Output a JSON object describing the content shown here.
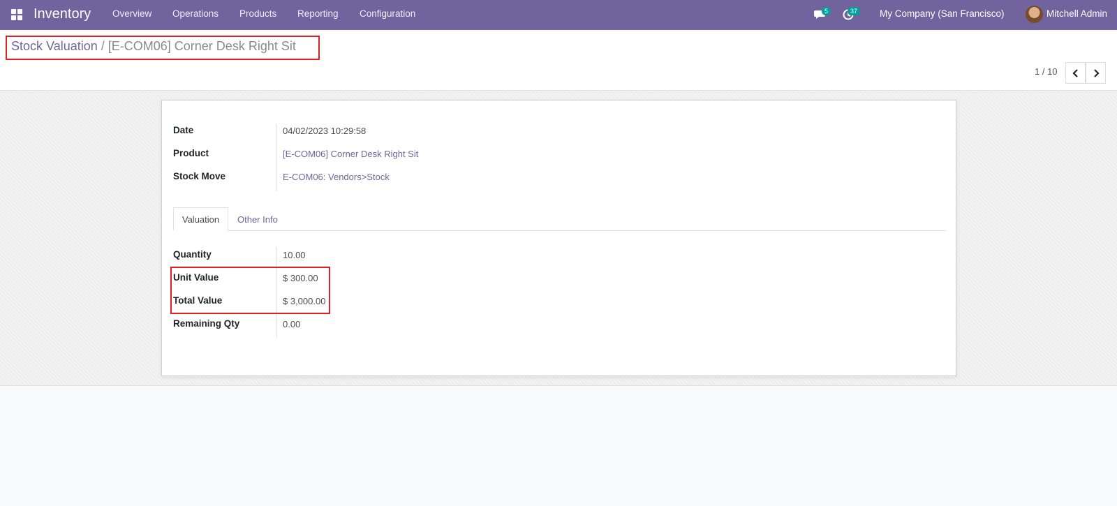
{
  "navbar": {
    "app_name": "Inventory",
    "menu": [
      "Overview",
      "Operations",
      "Products",
      "Reporting",
      "Configuration"
    ],
    "messages_count": "5",
    "activities_count": "37",
    "company": "My Company (San Francisco)",
    "user": "Mitchell Admin",
    "icons": [
      "apps-grid-icon",
      "chat-icon",
      "clock-icon"
    ]
  },
  "breadcrumb": {
    "parent": "Stock Valuation",
    "separator": "/",
    "current": "[E-COM06] Corner Desk Right Sit"
  },
  "pager": {
    "value": "1 / 10"
  },
  "form": {
    "fields": {
      "date_label": "Date",
      "date_value": "04/02/2023 10:29:58",
      "product_label": "Product",
      "product_value": "[E-COM06] Corner Desk Right Sit",
      "stock_move_label": "Stock Move",
      "stock_move_value": "E-COM06: Vendors>Stock"
    },
    "tabs": [
      "Valuation",
      "Other Info"
    ],
    "valuation": {
      "quantity_label": "Quantity",
      "quantity_value": "10.00",
      "unit_value_label": "Unit Value",
      "unit_value_value": "$ 300.00",
      "total_value_label": "Total Value",
      "total_value_value": "$ 3,000.00",
      "remaining_qty_label": "Remaining Qty",
      "remaining_qty_value": "0.00"
    }
  },
  "colors": {
    "brand": "#71639e",
    "badge": "#00a09d",
    "highlight": "#e02020"
  }
}
